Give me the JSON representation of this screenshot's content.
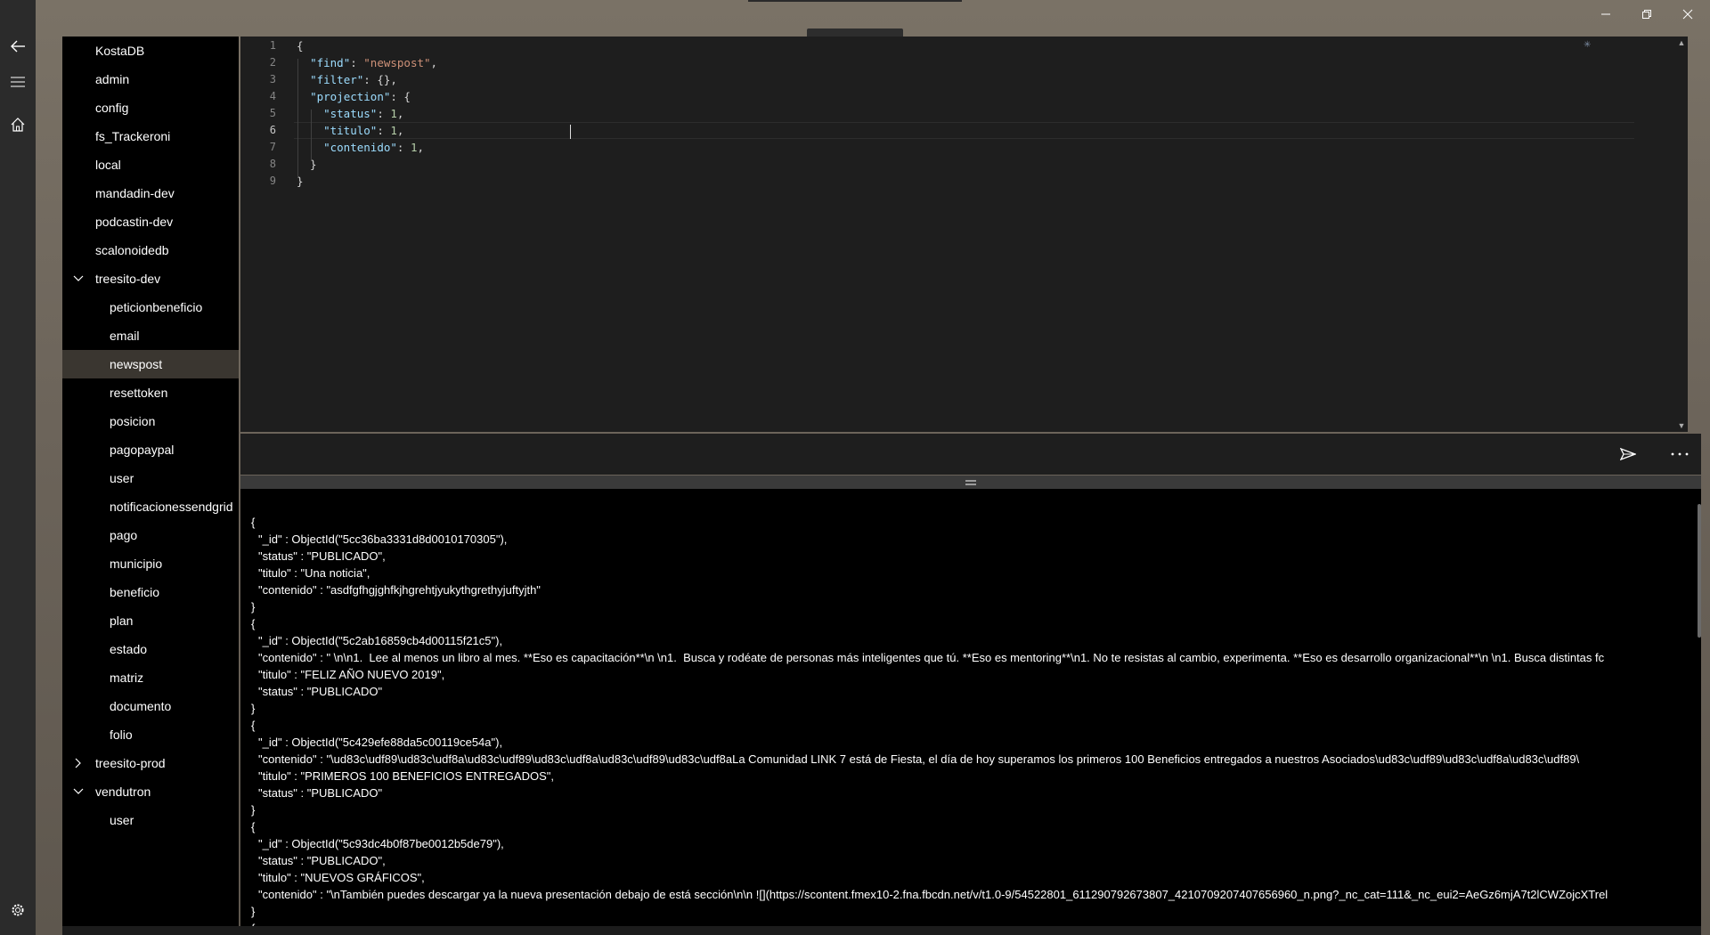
{
  "window": {
    "minimize_icon": "minimize-icon",
    "maximize_icon": "restore-icon",
    "close_icon": "close-icon"
  },
  "nav_rail": {
    "back_icon": "back-arrow-icon",
    "menu_icon": "hamburger-menu-icon",
    "home_icon": "home-icon",
    "settings_icon": "gear-icon"
  },
  "sidebar": {
    "items": [
      {
        "label": "KostaDB",
        "level": 0
      },
      {
        "label": "admin",
        "level": 0
      },
      {
        "label": "config",
        "level": 0
      },
      {
        "label": "fs_Trackeroni",
        "level": 0
      },
      {
        "label": "local",
        "level": 0
      },
      {
        "label": "mandadin-dev",
        "level": 0
      },
      {
        "label": "podcastin-dev",
        "level": 0
      },
      {
        "label": "scalonoidedb",
        "level": 0
      },
      {
        "label": "treesito-dev",
        "level": 0,
        "expanded": true
      },
      {
        "label": "peticionbeneficio",
        "level": 1
      },
      {
        "label": "email",
        "level": 1
      },
      {
        "label": "newspost",
        "level": 1,
        "selected": true
      },
      {
        "label": "resettoken",
        "level": 1
      },
      {
        "label": "posicion",
        "level": 1
      },
      {
        "label": "pagopaypal",
        "level": 1
      },
      {
        "label": "user",
        "level": 1
      },
      {
        "label": "notificacionessendgrid",
        "level": 1
      },
      {
        "label": "pago",
        "level": 1
      },
      {
        "label": "municipio",
        "level": 1
      },
      {
        "label": "beneficio",
        "level": 1
      },
      {
        "label": "plan",
        "level": 1
      },
      {
        "label": "estado",
        "level": 1
      },
      {
        "label": "matriz",
        "level": 1
      },
      {
        "label": "documento",
        "level": 1
      },
      {
        "label": "folio",
        "level": 1
      },
      {
        "label": "treesito-prod",
        "level": 0,
        "expanded": false
      },
      {
        "label": "vendutron",
        "level": 0,
        "expanded": true
      },
      {
        "label": "user",
        "level": 1
      }
    ]
  },
  "editor": {
    "line_numbers": [
      "1",
      "2",
      "3",
      "4",
      "5",
      "6",
      "7",
      "8",
      "9"
    ],
    "active_line": 6,
    "lines": [
      [
        {
          "t": "{",
          "c": "p"
        }
      ],
      [
        {
          "t": "  ",
          "c": "p"
        },
        {
          "t": "\"find\"",
          "c": "k"
        },
        {
          "t": ": ",
          "c": "p"
        },
        {
          "t": "\"newspost\"",
          "c": "s"
        },
        {
          "t": ",",
          "c": "p"
        }
      ],
      [
        {
          "t": "  ",
          "c": "p"
        },
        {
          "t": "\"filter\"",
          "c": "k"
        },
        {
          "t": ": {},",
          "c": "p"
        }
      ],
      [
        {
          "t": "  ",
          "c": "p"
        },
        {
          "t": "\"projection\"",
          "c": "k"
        },
        {
          "t": ": {",
          "c": "p"
        }
      ],
      [
        {
          "t": "    ",
          "c": "p"
        },
        {
          "t": "\"status\"",
          "c": "k"
        },
        {
          "t": ": ",
          "c": "p"
        },
        {
          "t": "1",
          "c": "n"
        },
        {
          "t": ",",
          "c": "p"
        }
      ],
      [
        {
          "t": "    ",
          "c": "p"
        },
        {
          "t": "\"titulo\"",
          "c": "k"
        },
        {
          "t": ": ",
          "c": "p"
        },
        {
          "t": "1",
          "c": "n"
        },
        {
          "t": ",",
          "c": "p"
        }
      ],
      [
        {
          "t": "    ",
          "c": "p"
        },
        {
          "t": "\"contenido\"",
          "c": "k"
        },
        {
          "t": ": ",
          "c": "p"
        },
        {
          "t": "1",
          "c": "n"
        },
        {
          "t": ",",
          "c": "p"
        }
      ],
      [
        {
          "t": "  }",
          "c": "p"
        }
      ],
      [
        {
          "t": "}",
          "c": "p"
        }
      ]
    ]
  },
  "toolbar": {
    "send_icon": "send-icon",
    "more_icon": "more-options-icon"
  },
  "results": {
    "lines": [
      {
        "text": "{",
        "ind": false
      },
      {
        "text": "\"_id\" : ObjectId(\"5cc36ba3331d8d0010170305\"),",
        "ind": true
      },
      {
        "text": "\"status\" : \"PUBLICADO\",",
        "ind": true
      },
      {
        "text": "\"titulo\" : \"Una noticia\",",
        "ind": true
      },
      {
        "text": "\"contenido\" : \"asdfgfhgjghfkjhgrehtjyukythgrethyjuftyjth\"",
        "ind": true
      },
      {
        "text": "}",
        "ind": false
      },
      {
        "text": "{",
        "ind": false
      },
      {
        "text": "\"_id\" : ObjectId(\"5c2ab16859cb4d00115f21c5\"),",
        "ind": true
      },
      {
        "text": "\"contenido\" : \" \\n\\n1.  Lee al menos un libro al mes. **Eso es capacitación**\\n \\n1.  Busca y rodéate de personas más inteligentes que tú. **Eso es mentoring**\\n1. No te resistas al cambio, experimenta. **Eso es desarrollo organizacional**\\n \\n1. Busca distintas fc",
        "ind": true
      },
      {
        "text": "\"titulo\" : \"FELIZ AÑO NUEVO 2019\",",
        "ind": true
      },
      {
        "text": "\"status\" : \"PUBLICADO\"",
        "ind": true
      },
      {
        "text": "}",
        "ind": false
      },
      {
        "text": "{",
        "ind": false
      },
      {
        "text": "\"_id\" : ObjectId(\"5c429efe88da5c00119ce54a\"),",
        "ind": true
      },
      {
        "text": "\"contenido\" : \"\\ud83c\\udf89\\ud83c\\udf8a\\ud83c\\udf89\\ud83c\\udf8a\\ud83c\\udf89\\ud83c\\udf8aLa Comunidad LINK 7 está de Fiesta, el día de hoy superamos los primeros 100 Beneficios entregados a nuestros Asociados\\ud83c\\udf89\\ud83c\\udf8a\\ud83c\\udf89\\",
        "ind": true
      },
      {
        "text": "\"titulo\" : \"PRIMEROS 100 BENEFICIOS ENTREGADOS\",",
        "ind": true
      },
      {
        "text": "\"status\" : \"PUBLICADO\"",
        "ind": true
      },
      {
        "text": "}",
        "ind": false
      },
      {
        "text": "{",
        "ind": false
      },
      {
        "text": "\"_id\" : ObjectId(\"5c93dc4b0f87be0012b5de79\"),",
        "ind": true
      },
      {
        "text": "\"status\" : \"PUBLICADO\",",
        "ind": true
      },
      {
        "text": "\"titulo\" : \"NUEVOS GRÁFICOS\",",
        "ind": true
      },
      {
        "text": "\"contenido\" : \"\\nTambién puedes descargar ya la nueva presentación debajo de está sección\\n\\n ![](https://scontent.fmex10-2.fna.fbcdn.net/v/t1.0-9/54522801_611290792673807_4210709207407656960_n.png?_nc_cat=111&_nc_eui2=AeGz6mjA7t2lCWZojcXTrel",
        "ind": true
      },
      {
        "text": "}",
        "ind": false
      },
      {
        "text": "{",
        "ind": false
      }
    ]
  }
}
